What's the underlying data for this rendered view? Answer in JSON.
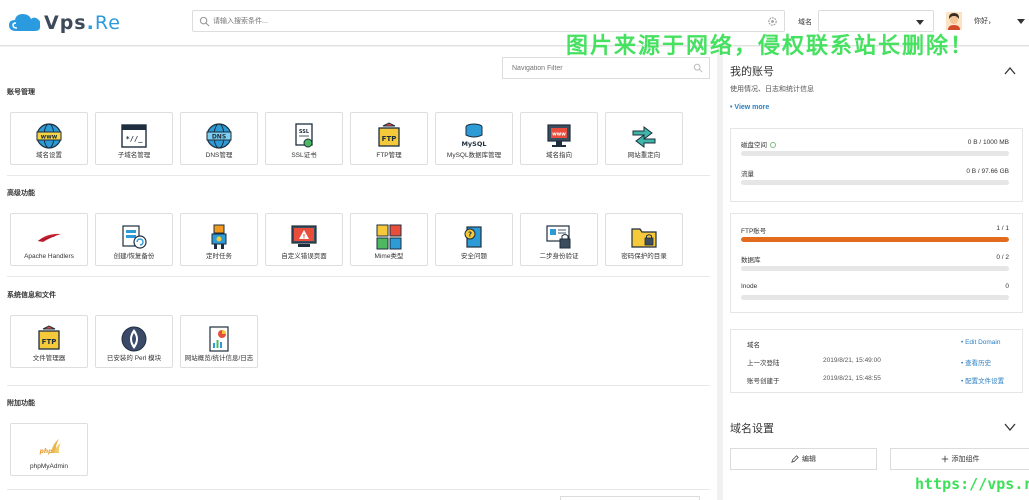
{
  "header": {
    "logo_main": "Vps",
    "logo_dot": ".",
    "logo_suffix": "Re",
    "search_placeholder": "请输入搜索条件...",
    "domain_label": "域名",
    "domain_value": "",
    "greeting": "你好，"
  },
  "watermark": {
    "text": "图片来源于网络，侵权联系站长删除！",
    "url": "https://vps.re"
  },
  "nav_filter": {
    "placeholder": "Navigation Filter"
  },
  "sections": [
    {
      "title": "账号管理",
      "items": [
        {
          "label": "域名设置",
          "icon": "www-globe-icon"
        },
        {
          "label": "子域名管理",
          "icon": "subdomain-terminal-icon"
        },
        {
          "label": "DNS管理",
          "icon": "dns-globe-icon"
        },
        {
          "label": "SSL证书",
          "icon": "ssl-certificate-icon"
        },
        {
          "label": "FTP管理",
          "icon": "ftp-folder-icon"
        },
        {
          "label": "MySQL数据库管理",
          "icon": "mysql-database-icon"
        },
        {
          "label": "域名指向",
          "icon": "domain-pointer-monitor-icon"
        },
        {
          "label": "网站重定向",
          "icon": "redirect-arrows-icon"
        }
      ]
    },
    {
      "title": "高级功能",
      "items": [
        {
          "label": "Apache Handlers",
          "icon": "apache-feather-icon"
        },
        {
          "label": "创建/恢复备份",
          "icon": "backup-restore-icon"
        },
        {
          "label": "定时任务",
          "icon": "cron-robot-icon"
        },
        {
          "label": "自定义错误页面",
          "icon": "error-page-warning-icon"
        },
        {
          "label": "Mime类型",
          "icon": "mime-types-icon"
        },
        {
          "label": "安全问题",
          "icon": "security-question-icon"
        },
        {
          "label": "二步身份验证",
          "icon": "two-factor-auth-icon"
        },
        {
          "label": "密码保护的目录",
          "icon": "password-protected-folder-icon"
        }
      ]
    },
    {
      "title": "系统信息和文件",
      "items": [
        {
          "label": "文件管理器",
          "icon": "file-manager-ftp-icon"
        },
        {
          "label": "已安装的 Perl 模块",
          "icon": "perl-onion-icon"
        },
        {
          "label": "网站概览/统计信息/日志",
          "icon": "site-stats-chart-icon"
        }
      ]
    },
    {
      "title": "附加功能",
      "items": [
        {
          "label": "phpMyAdmin",
          "icon": "phpmyadmin-logo-icon"
        }
      ]
    }
  ],
  "account": {
    "title": "我的账号",
    "subtitle": "使用情况、日志和统计信息",
    "view_more": "• View more",
    "stats_group1": [
      {
        "name": "磁盘空间",
        "value": "0 B / 1000 MB",
        "fraction": 0
      },
      {
        "name": "流量",
        "value": "0 B / 97.66 GB",
        "fraction": 0
      }
    ],
    "stats_group2": [
      {
        "name": "FTP账号",
        "value": "1 / 1",
        "fraction": 1
      },
      {
        "name": "数据库",
        "value": "0 / 2",
        "fraction": 0
      },
      {
        "name": "Inode",
        "value": "0",
        "fraction": 0
      }
    ],
    "info": [
      {
        "key": "域名",
        "value": "",
        "action": "• Edit Domain"
      },
      {
        "key": "上一次登陆",
        "value": "2019/8/21, 15:49:00",
        "action": "• 查看历史"
      },
      {
        "key": "账号创建于",
        "value": "2019/8/21, 15:48:55",
        "action": "• 配置文件设置"
      }
    ]
  },
  "domain_settings": {
    "title": "域名设置",
    "edit_label": "编辑",
    "add_label": "添加组件"
  },
  "colors": {
    "accent_blue": "#2b9be0",
    "link_blue": "#2b7fc2",
    "progress_orange": "#e36b1e",
    "watermark_green": "#3ee05a"
  }
}
